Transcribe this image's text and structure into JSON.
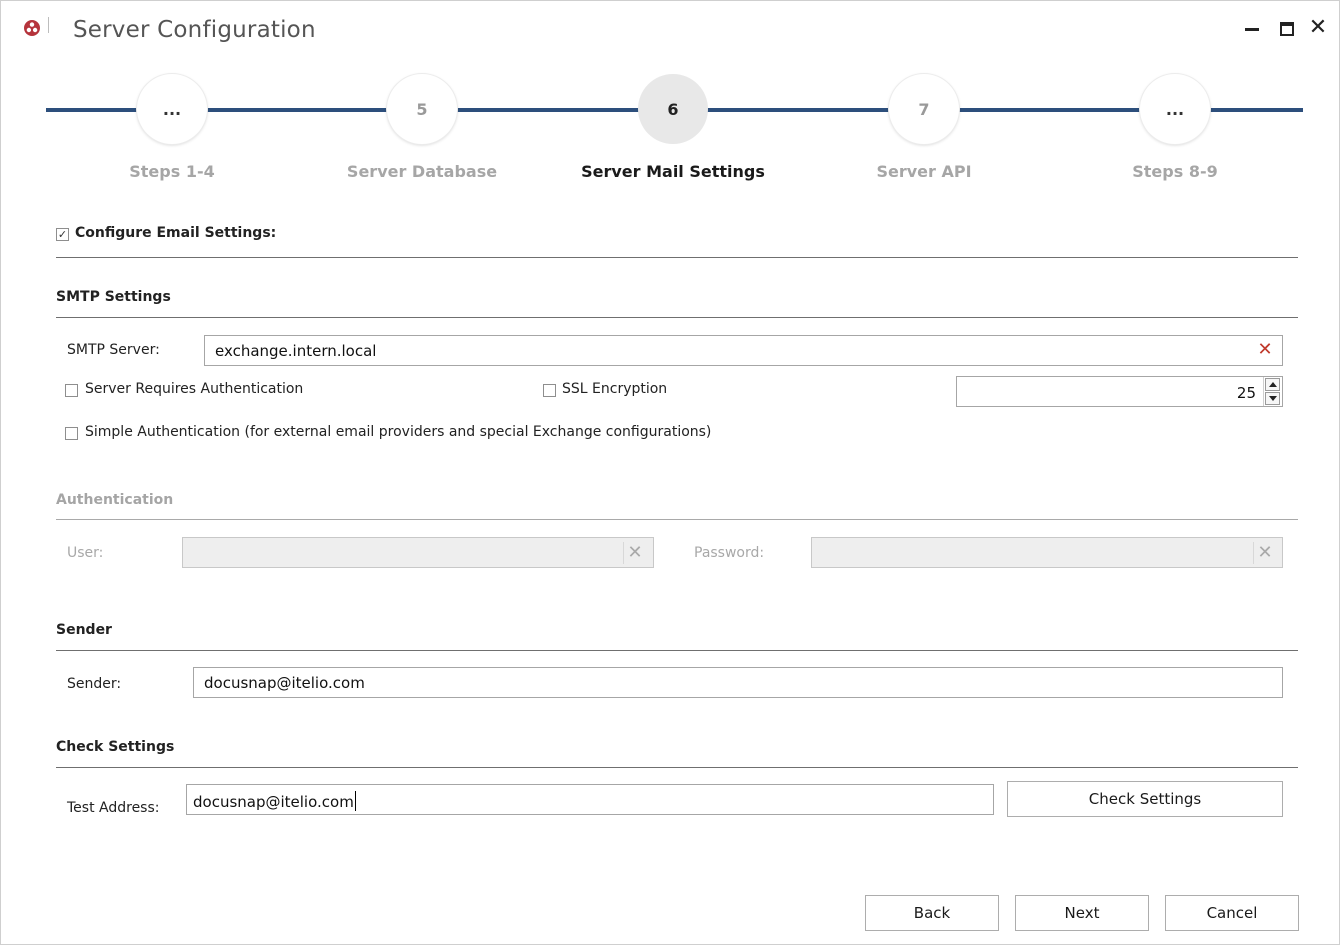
{
  "window": {
    "title": "Server Configuration",
    "close_glyph": "✕"
  },
  "icons": {
    "app": "app-logo-icon",
    "minimize": "minimize-icon",
    "maximize": "maximize-icon",
    "close": "close-icon",
    "clear": "clear-icon"
  },
  "colors": {
    "step_line": "#2d4f7c",
    "clear_active": "#c0392b",
    "app_logo": "#b5343c"
  },
  "stepper": {
    "steps": [
      {
        "number": "...",
        "label": "Steps 1-4"
      },
      {
        "number": "5",
        "label": "Server Database"
      },
      {
        "number": "6",
        "label": "Server Mail Settings"
      },
      {
        "number": "7",
        "label": "Server API"
      },
      {
        "number": "...",
        "label": "Steps 8-9"
      }
    ],
    "active_index": 2
  },
  "configure_email": {
    "label": "Configure Email Settings:",
    "checked": true,
    "check_glyph": "✓"
  },
  "smtp": {
    "section_title": "SMTP Settings",
    "server_label": "SMTP Server:",
    "server_value": "exchange.intern.local",
    "clear_glyph": "✕",
    "requires_auth_label": "Server Requires Authentication",
    "ssl_label": "SSL Encryption",
    "port_value": "25",
    "simple_auth_label": "Simple Authentication (for external email providers and special Exchange configurations)"
  },
  "authentication": {
    "section_title": "Authentication",
    "user_label": "User:",
    "user_value": "",
    "password_label": "Password:",
    "password_value": "",
    "clear_glyph": "✕"
  },
  "sender": {
    "section_title": "Sender",
    "label": "Sender:",
    "value": "docusnap@itelio.com"
  },
  "check": {
    "section_title": "Check Settings",
    "test_label": "Test Address:",
    "test_value": "docusnap@itelio.com",
    "button_label": "Check Settings"
  },
  "footer": {
    "back": "Back",
    "next": "Next",
    "cancel": "Cancel"
  }
}
